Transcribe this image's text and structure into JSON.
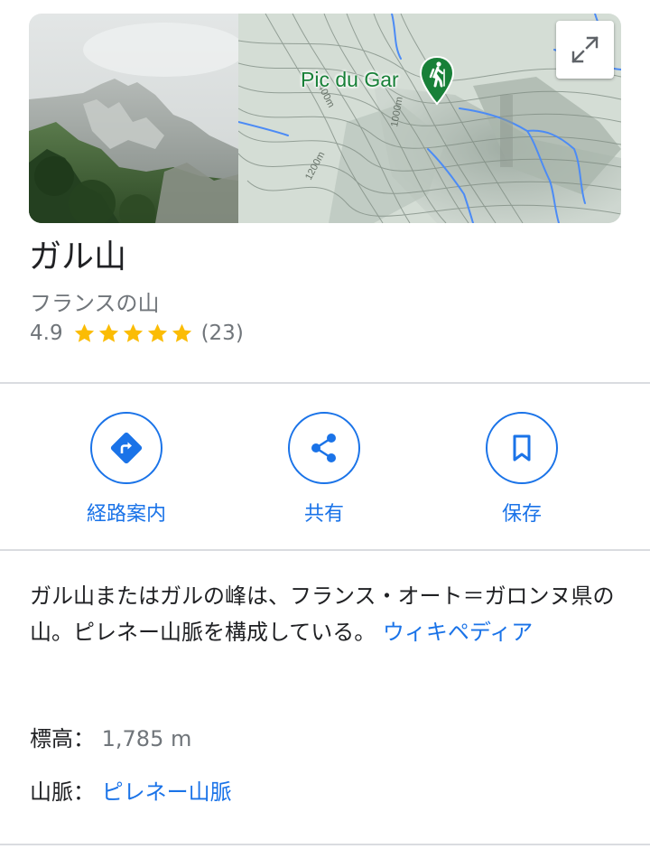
{
  "map": {
    "pin_label": "Pic du Gar",
    "contour_labels": [
      "1400m",
      "1200m",
      "1000m"
    ]
  },
  "place": {
    "title": "ガル山",
    "subtitle": "フランスの山",
    "rating": "4.9",
    "stars": 5,
    "review_count": "(23)"
  },
  "actions": [
    {
      "label": "経路案内",
      "icon": "directions-icon"
    },
    {
      "label": "共有",
      "icon": "share-icon"
    },
    {
      "label": "保存",
      "icon": "bookmark-icon"
    }
  ],
  "description": {
    "text": "ガル山またはガルの峰は、フランス・オート＝ガロンヌ県の山。ピレネー山脈を構成している。",
    "link": "ウィキペディア"
  },
  "facts": {
    "elevation_label": "標高：",
    "elevation_value": "1,785 m",
    "range_label": "山脈：",
    "range_value": "ピレネー山脈"
  },
  "colors": {
    "link_blue": "#1a73e8",
    "star_gold": "#fbbc04",
    "pin_green": "#188038",
    "divider": "#dadce0"
  }
}
